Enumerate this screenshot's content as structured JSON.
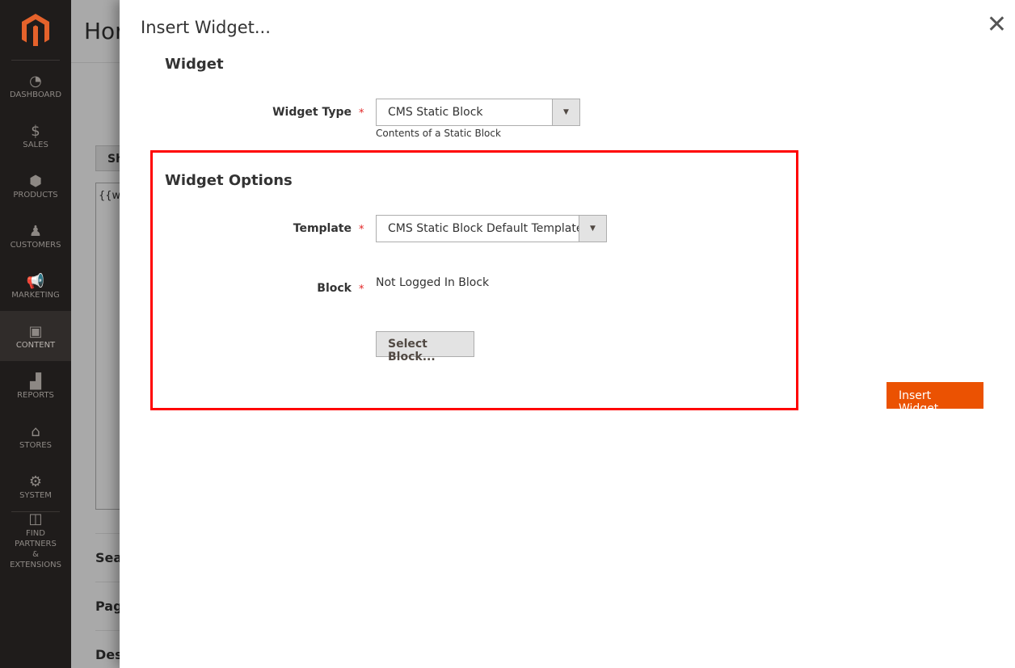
{
  "sidebar": {
    "items": [
      {
        "label": "Dashboard",
        "icon": "gauge-icon",
        "glyph": "◔"
      },
      {
        "label": "Sales",
        "icon": "dollar-icon",
        "glyph": "$"
      },
      {
        "label": "Products",
        "icon": "box-icon",
        "glyph": "⬢"
      },
      {
        "label": "Customers",
        "icon": "person-icon",
        "glyph": "♟"
      },
      {
        "label": "Marketing",
        "icon": "megaphone-icon",
        "glyph": "📢"
      },
      {
        "label": "Content",
        "icon": "layout-icon",
        "glyph": "▣",
        "active": true
      },
      {
        "label": "Reports",
        "icon": "bar-chart-icon",
        "glyph": "▟"
      },
      {
        "label": "Stores",
        "icon": "storefront-icon",
        "glyph": "⌂"
      },
      {
        "label": "System",
        "icon": "gear-icon",
        "glyph": "⚙"
      }
    ],
    "partners": {
      "line1": "Find Partners",
      "line2": "& Extensions",
      "icon": "lego-brick-icon"
    }
  },
  "background": {
    "title": "Hor",
    "button": "Sh",
    "editor": "{{wic",
    "sections": [
      "Sea",
      "Pag",
      "Des"
    ]
  },
  "modal": {
    "title": "Insert Widget...",
    "close_icon": "close-icon",
    "widget_section": "Widget",
    "widget_type_label": "Widget Type",
    "widget_type_value": "CMS Static Block",
    "widget_type_note": "Contents of a Static Block",
    "options_section": "Widget Options",
    "template_label": "Template",
    "template_value": "CMS Static Block Default Template",
    "block_label": "Block",
    "block_value": "Not Logged In Block",
    "select_block_button": "Select Block...",
    "insert_button": "Insert Widget",
    "required_mark": "*"
  },
  "colors": {
    "accent": "#eb5202",
    "highlight_box": "#ff0000",
    "required": "#e22626"
  }
}
